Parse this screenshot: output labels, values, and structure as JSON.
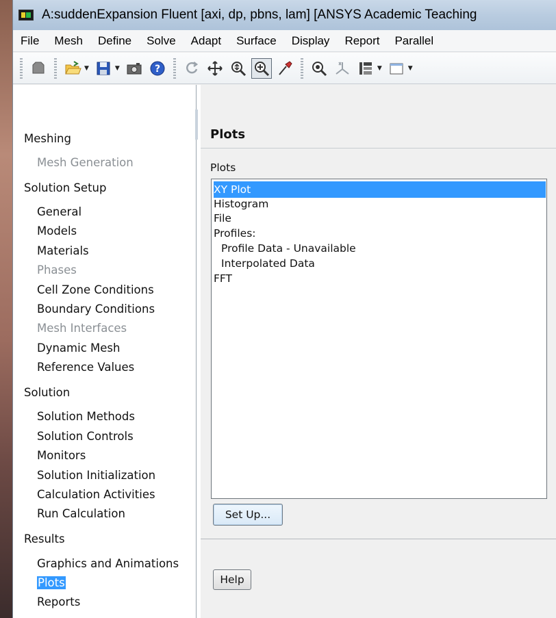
{
  "window": {
    "title": "A:suddenExpansion Fluent  [axi, dp, pbns, lam] [ANSYS Academic Teaching"
  },
  "menu": [
    "File",
    "Mesh",
    "Define",
    "Solve",
    "Adapt",
    "Surface",
    "Display",
    "Report",
    "Parallel"
  ],
  "toolbar": {
    "icons": [
      "mesh-icon",
      "open-folder-icon",
      "save-disk-icon",
      "camera-icon",
      "help-circle-icon",
      "rotate-icon",
      "move-icon",
      "zoom-icon",
      "zoom-box-icon",
      "probe-icon",
      "zoom-fit-icon",
      "axes-icon",
      "layout-icon",
      "window-icon"
    ]
  },
  "nav": {
    "items": [
      {
        "label": "Meshing",
        "type": "header",
        "disabled": false
      },
      {
        "label": "Mesh Generation",
        "type": "item",
        "disabled": true
      },
      {
        "label": "Solution Setup",
        "type": "header",
        "disabled": false
      },
      {
        "label": "General",
        "type": "item",
        "disabled": false
      },
      {
        "label": "Models",
        "type": "item",
        "disabled": false
      },
      {
        "label": "Materials",
        "type": "item",
        "disabled": false
      },
      {
        "label": "Phases",
        "type": "item",
        "disabled": true
      },
      {
        "label": "Cell Zone Conditions",
        "type": "item",
        "disabled": false
      },
      {
        "label": "Boundary Conditions",
        "type": "item",
        "disabled": false
      },
      {
        "label": "Mesh Interfaces",
        "type": "item",
        "disabled": true
      },
      {
        "label": "Dynamic Mesh",
        "type": "item",
        "disabled": false
      },
      {
        "label": "Reference Values",
        "type": "item",
        "disabled": false
      },
      {
        "label": "Solution",
        "type": "header",
        "disabled": false
      },
      {
        "label": "Solution Methods",
        "type": "item",
        "disabled": false
      },
      {
        "label": "Solution Controls",
        "type": "item",
        "disabled": false
      },
      {
        "label": "Monitors",
        "type": "item",
        "disabled": false
      },
      {
        "label": "Solution Initialization",
        "type": "item",
        "disabled": false
      },
      {
        "label": "Calculation Activities",
        "type": "item",
        "disabled": false
      },
      {
        "label": "Run Calculation",
        "type": "item",
        "disabled": false
      },
      {
        "label": "Results",
        "type": "header",
        "disabled": false
      },
      {
        "label": "Graphics and Animations",
        "type": "item",
        "disabled": false
      },
      {
        "label": "Plots",
        "type": "item",
        "disabled": false,
        "selected": true
      },
      {
        "label": "Reports",
        "type": "item",
        "disabled": false
      }
    ]
  },
  "panel": {
    "title": "Plots",
    "list_label": "Plots",
    "list_items": [
      {
        "label": "XY Plot",
        "selected": true,
        "indent": false
      },
      {
        "label": "Histogram",
        "selected": false,
        "indent": false
      },
      {
        "label": "File",
        "selected": false,
        "indent": false
      },
      {
        "label": "Profiles:",
        "selected": false,
        "indent": false
      },
      {
        "label": "Profile Data - Unavailable",
        "selected": false,
        "indent": true
      },
      {
        "label": "Interpolated Data",
        "selected": false,
        "indent": true
      },
      {
        "label": "FFT",
        "selected": false,
        "indent": false
      }
    ],
    "setup_label": "Set Up...",
    "help_label": "Help"
  }
}
